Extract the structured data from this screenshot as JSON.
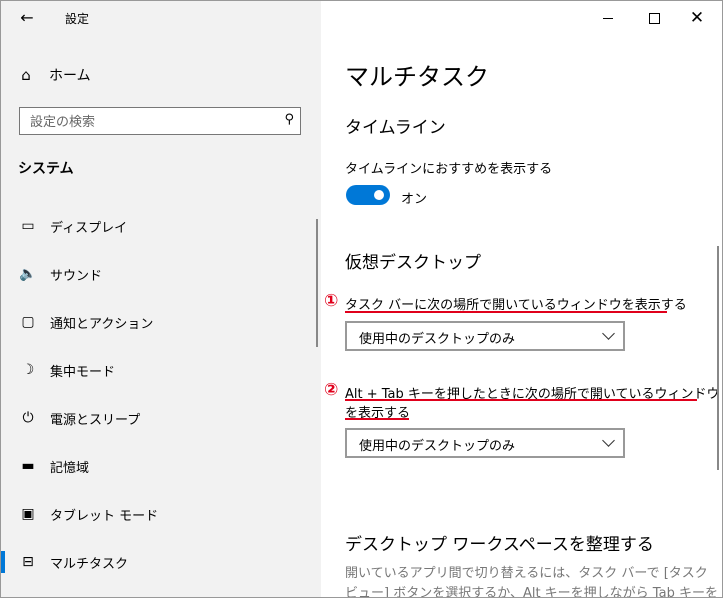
{
  "window": {
    "title": "設定"
  },
  "sidebar": {
    "home": "ホーム",
    "search_placeholder": "設定の検索",
    "section": "システム",
    "items": [
      {
        "label": "ディスプレイ",
        "icon": "monitor-icon"
      },
      {
        "label": "サウンド",
        "icon": "speaker-icon"
      },
      {
        "label": "通知とアクション",
        "icon": "notification-icon"
      },
      {
        "label": "集中モード",
        "icon": "moon-icon"
      },
      {
        "label": "電源とスリープ",
        "icon": "power-icon"
      },
      {
        "label": "記憶域",
        "icon": "storage-icon"
      },
      {
        "label": "タブレット モード",
        "icon": "tablet-icon"
      },
      {
        "label": "マルチタスク",
        "icon": "multitask-icon",
        "active": true
      }
    ]
  },
  "main": {
    "title": "マルチタスク",
    "timeline": {
      "heading": "タイムライン",
      "setting_label": "タイムラインにおすすめを表示する",
      "toggle_state": "オン"
    },
    "virtual_desktops": {
      "heading": "仮想デスクトップ",
      "marker1": "①",
      "setting1": "タスク バーに次の場所で開いているウィンドウを表示する",
      "dropdown1": "使用中のデスクトップのみ",
      "marker2": "②",
      "setting2_line1": "Alt + Tab キーを押したときに次の場所で開いているウィンドウ",
      "setting2_line2": "を表示する",
      "dropdown2": "使用中のデスクトップのみ"
    },
    "workspace": {
      "heading": "デスクトップ ワークスペースを整理する",
      "desc_line1": "開いているアプリ間で切り替えるには、タスク バーで [タスク",
      "desc_line2": "ビュー] ボタンを選択するか、Alt キーを押しながら Tab キーを"
    }
  },
  "colors": {
    "accent": "#0078d7",
    "annotation": "#e0001b"
  }
}
